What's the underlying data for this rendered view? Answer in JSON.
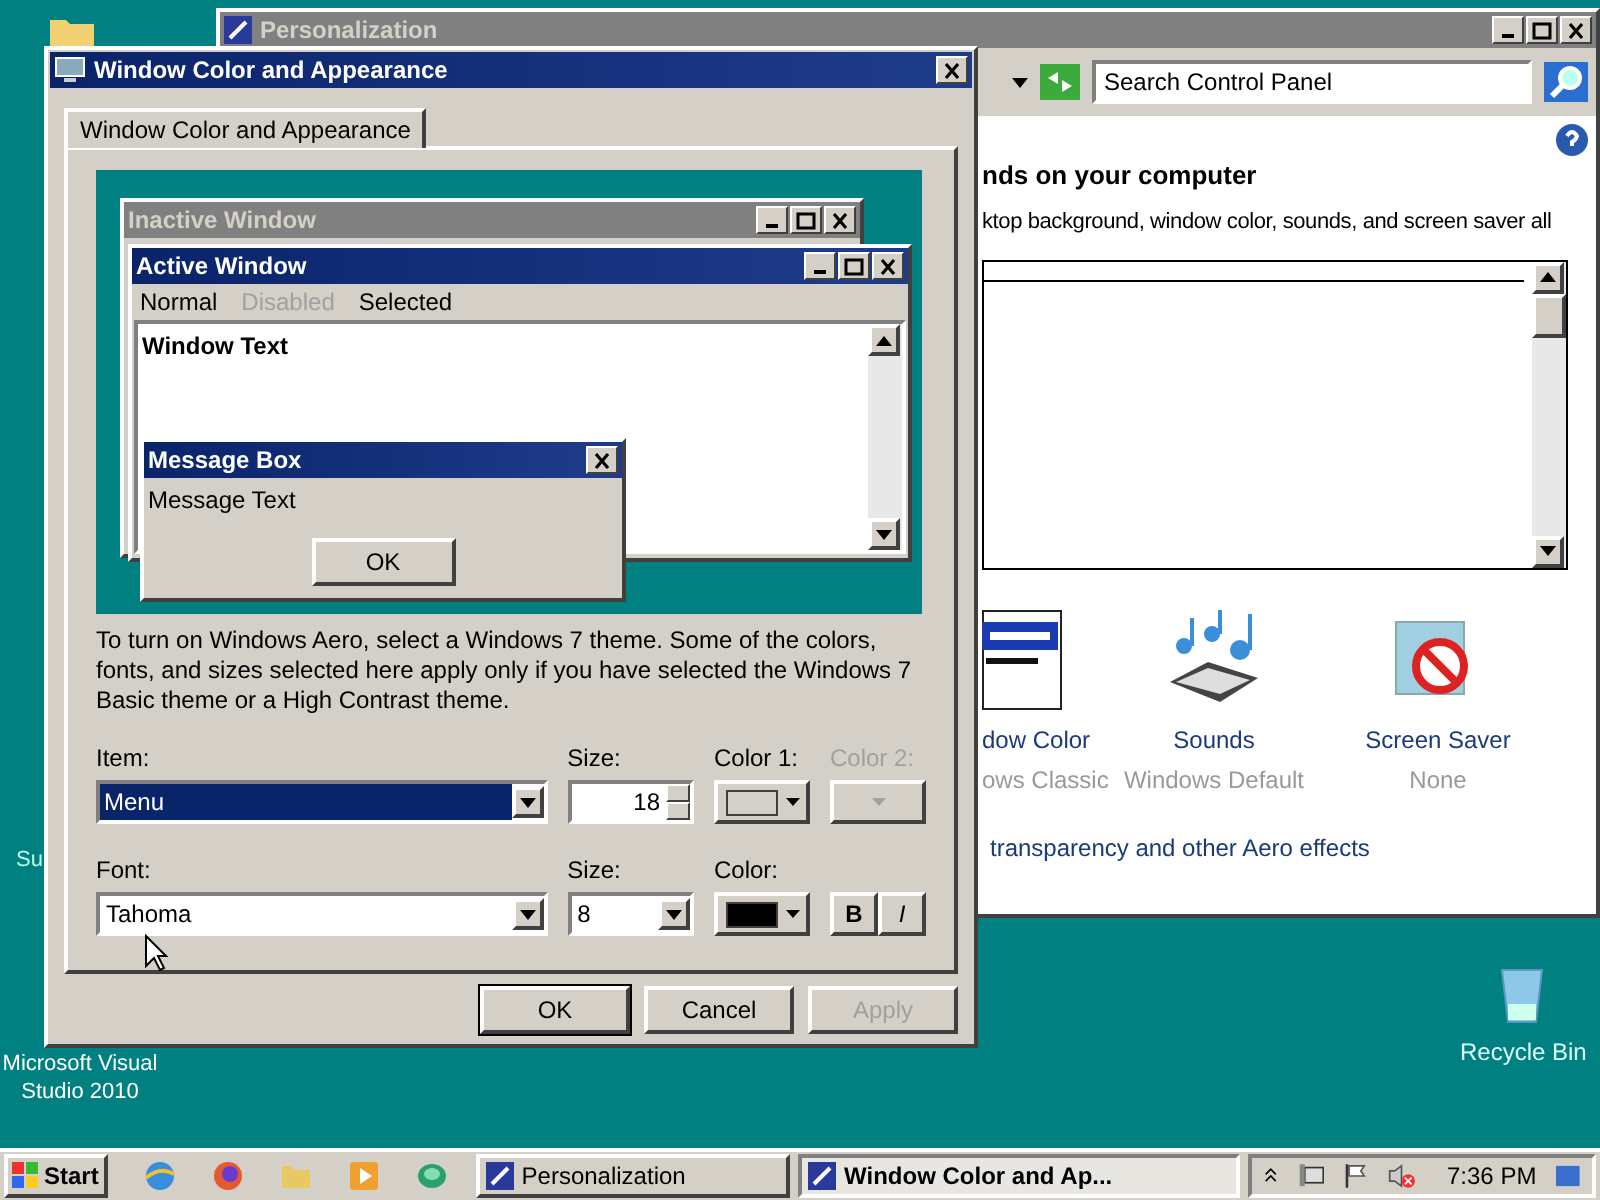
{
  "desktop_icons": [
    {
      "label": "Su"
    },
    {
      "label": "Microsoft Visual Studio 2010"
    },
    {
      "label": "Recycle Bin"
    }
  ],
  "background_window": {
    "title": "Personalization",
    "search": {
      "placeholder": "Search Control Panel"
    },
    "heading": "nds on your computer",
    "description": "ktop background, window color, sounds, and screen saver all",
    "items": [
      {
        "kind": "window",
        "title": "dow Color",
        "subtitle": "ows Classic"
      },
      {
        "kind": "sounds",
        "title": "Sounds",
        "subtitle": "Windows Default"
      },
      {
        "kind": "screensaver",
        "title": "Screen Saver",
        "subtitle": "None"
      }
    ],
    "link": "transparency and other Aero effects"
  },
  "dialog": {
    "title": "Window Color and Appearance",
    "tabs": [
      {
        "label": "Window Color and Appearance",
        "selected": true
      }
    ],
    "preview": {
      "inactive_title": "Inactive Window",
      "active_title": "Active Window",
      "menu": [
        {
          "label": "Normal",
          "disabled": false
        },
        {
          "label": "Disabled",
          "disabled": true
        },
        {
          "label": "Selected",
          "disabled": false
        }
      ],
      "window_text": "Window Text",
      "message_box": {
        "title": "Message Box",
        "text": "Message Text",
        "button": "OK"
      }
    },
    "description": "To turn on Windows Aero, select a Windows 7 theme.  Some of the colors, fonts, and sizes selected here apply only if you have selected the Windows 7 Basic theme or a High Contrast theme.",
    "item": {
      "label": "Item:",
      "value": "Menu"
    },
    "item_size": {
      "label": "Size:",
      "value": "18"
    },
    "color1": {
      "label": "Color 1:",
      "color": "#d4d0c8",
      "disabled": false
    },
    "color2": {
      "label": "Color 2:",
      "disabled": true
    },
    "font": {
      "label": "Font:",
      "value": "Tahoma"
    },
    "font_size": {
      "label": "Size:",
      "value": "8"
    },
    "font_color": {
      "label": "Color:",
      "color": "#000000",
      "disabled": false
    },
    "bold": {
      "label": "B"
    },
    "italic": {
      "label": "I"
    },
    "buttons": [
      {
        "label": "OK",
        "default": true,
        "disabled": false
      },
      {
        "label": "Cancel",
        "default": false,
        "disabled": false
      },
      {
        "label": "Apply",
        "default": false,
        "disabled": true
      }
    ]
  },
  "taskbar": {
    "start": "Start",
    "tasks": [
      {
        "label": "Personalization",
        "selected": false
      },
      {
        "label": "Window Color and Ap...",
        "selected": true
      }
    ],
    "clock": "7:36 PM"
  }
}
